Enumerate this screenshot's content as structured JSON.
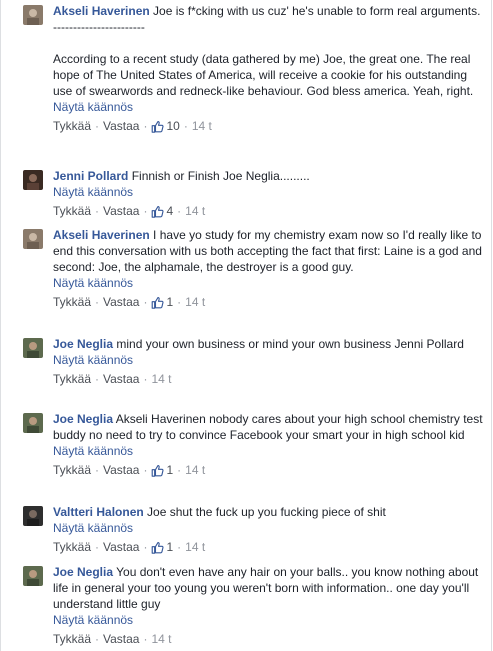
{
  "labels": {
    "translate": "Näytä käännös",
    "like": "Tykkää",
    "reply": "Vastaa"
  },
  "colors": {
    "link": "#365899",
    "meta": "#90949c",
    "text": "#1d2129"
  },
  "comments": [
    {
      "author": "Akseli Haverinen",
      "text": " Joe is f*cking with us cuz' he's unable to form real arguments.\n-----------------------\n\nAccording to a recent study (data gathered by me) Joe, the great one. The real hope of The United States of America, will receive a cookie for his outstanding use of swearwords and redneck-like behaviour. God bless america. Yeah, right.",
      "likes": "10",
      "time": "14 t",
      "avatar_color": "#8a7a6a"
    },
    {
      "author": "Jenni Pollard",
      "text": " Finnish or Finish Joe Neglia.........",
      "likes": "4",
      "time": "14 t",
      "avatar_color": "#3a2a22"
    },
    {
      "author": "Akseli Haverinen",
      "text": " I have yo study for my chemistry exam now so I'd really like to end this conversation with us both accepting the fact that first: Laine is a god and second: Joe, the alphamale, the destroyer is a good guy.",
      "likes": "1",
      "time": "14 t",
      "avatar_color": "#8a7a6a"
    },
    {
      "author": "Joe Neglia",
      "text": " mind your own business or mind your own business Jenni Pollard",
      "likes": "",
      "time": "14 t",
      "avatar_color": "#5d6a4e"
    },
    {
      "author": "Joe Neglia",
      "text": " Akseli Haverinen nobody cares about your high school chemistry test buddy no need to try to convince Facebook your smart your in high school kid",
      "likes": "1",
      "time": "14 t",
      "avatar_color": "#5d6a4e"
    },
    {
      "author": "Valtteri Halonen",
      "text": " Joe shut the fuck up you fucking piece of shit",
      "likes": "1",
      "time": "14 t",
      "avatar_color": "#2e2e2e"
    },
    {
      "author": "Joe Neglia",
      "text": " You don't even have any hair on your balls.. you know nothing about life in general your too young you weren't born with information.. one day you'll understand little guy",
      "likes": "",
      "time": "14 t",
      "avatar_color": "#5d6a4e"
    }
  ]
}
